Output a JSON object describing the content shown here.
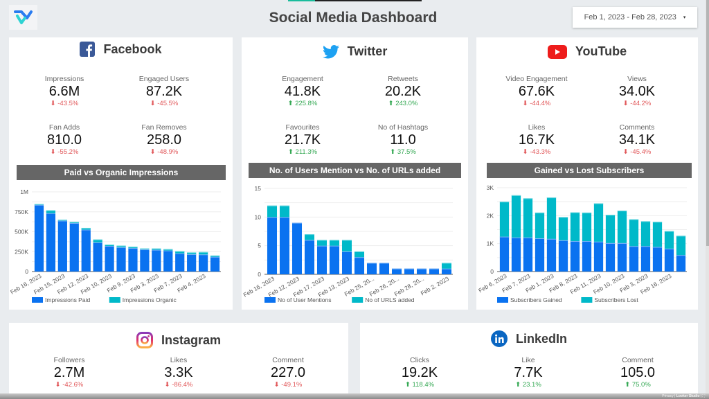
{
  "header": {
    "title": "Social Media Dashboard",
    "date_range": "Feb 1, 2023 - Feb 28, 2023",
    "date_caret": "▾",
    "logo_icon": "v-logo-icon"
  },
  "colors": {
    "primary_bar": "#0a72f0",
    "secondary_bar": "#00b9c9",
    "negative": "#e15759",
    "positive": "#34a853",
    "chart_title_bg": "#666666"
  },
  "facebook": {
    "name": "Facebook",
    "icon": "facebook-icon",
    "kpis": [
      {
        "label": "Impressions",
        "value": "6.6M",
        "change": "-43.5%",
        "dir": "down"
      },
      {
        "label": "Engaged Users",
        "value": "87.2K",
        "change": "-45.5%",
        "dir": "down"
      },
      {
        "label": "Fan Adds",
        "value": "810.0",
        "change": "-55.2%",
        "dir": "down"
      },
      {
        "label": "Fan Removes",
        "value": "258.0",
        "change": "-48.9%",
        "dir": "down"
      }
    ]
  },
  "twitter": {
    "name": "Twitter",
    "icon": "twitter-icon",
    "kpis": [
      {
        "label": "Engagement",
        "value": "41.8K",
        "change": "225.8%",
        "dir": "up"
      },
      {
        "label": "Retweets",
        "value": "20.2K",
        "change": "243.0%",
        "dir": "up"
      },
      {
        "label": "Favourites",
        "value": "21.7K",
        "change": "211.3%",
        "dir": "up"
      },
      {
        "label": "No of Hashtags",
        "value": "11.0",
        "change": "37.5%",
        "dir": "up"
      }
    ]
  },
  "youtube": {
    "name": "YouTube",
    "icon": "youtube-icon",
    "kpis": [
      {
        "label": "Video Engagement",
        "value": "67.6K",
        "change": "-44.4%",
        "dir": "down"
      },
      {
        "label": "Views",
        "value": "34.0K",
        "change": "-44.2%",
        "dir": "down"
      },
      {
        "label": "Likes",
        "value": "16.7K",
        "change": "-43.3%",
        "dir": "down"
      },
      {
        "label": "Comments",
        "value": "34.1K",
        "change": "-45.4%",
        "dir": "down"
      }
    ]
  },
  "instagram": {
    "name": "Instagram",
    "icon": "instagram-icon",
    "kpis": [
      {
        "label": "Followers",
        "value": "2.7M",
        "change": "-42.6%",
        "dir": "down"
      },
      {
        "label": "Likes",
        "value": "3.3K",
        "change": "-86.4%",
        "dir": "down"
      },
      {
        "label": "Comment",
        "value": "227.0",
        "change": "-49.1%",
        "dir": "down"
      }
    ]
  },
  "linkedin": {
    "name": "LinkedIn",
    "icon": "linkedin-icon",
    "kpis": [
      {
        "label": "Clicks",
        "value": "19.2K",
        "change": "118.4%",
        "dir": "up"
      },
      {
        "label": "Like",
        "value": "7.7K",
        "change": "23.1%",
        "dir": "up"
      },
      {
        "label": "Comment",
        "value": "105.0",
        "change": "75.0%",
        "dir": "up"
      }
    ]
  },
  "footer": {
    "privacy": "Privacy",
    "brand": "Looker Studio",
    "fullscreen_icon": "⛶"
  },
  "chart_data": [
    {
      "id": "fb",
      "type": "bar",
      "stacked": true,
      "title": "Paid vs Organic Impressions",
      "ylim": [
        0,
        1000000
      ],
      "yticks": [
        0,
        250000,
        500000,
        750000,
        1000000
      ],
      "ytick_labels": [
        "0",
        "250K",
        "500K",
        "750K",
        "1M"
      ],
      "grid": true,
      "legend": "bottom",
      "tick_labels": [
        "Feb 16, 2023",
        "Feb 15, 2023",
        "Feb 12, 2023",
        "Feb 10, 2023",
        "Feb 9, 2023",
        "Feb 3, 2023",
        "Feb 7, 2023",
        "Feb 4, 2023"
      ],
      "series": [
        {
          "name": "Impressions Paid",
          "values": [
            837000,
            733000,
            639000,
            609000,
            526000,
            366000,
            322000,
            306000,
            295000,
            278000,
            273000,
            264000,
            229000,
            218000,
            215000,
            185000
          ]
        },
        {
          "name": "Impressions Organic",
          "values": [
            11000,
            36000,
            11000,
            14000,
            22000,
            36000,
            17000,
            19000,
            16000,
            11000,
            16000,
            17000,
            27000,
            22000,
            30000,
            16000
          ]
        }
      ]
    },
    {
      "id": "tw",
      "type": "bar",
      "stacked": true,
      "title": "No. of Users Mention vs No. of URLs added",
      "ylim": [
        0,
        15
      ],
      "yticks": [
        0,
        5,
        10,
        15
      ],
      "ytick_labels": [
        "0",
        "5",
        "10",
        "15"
      ],
      "grid": true,
      "legend": "bottom",
      "tick_labels": [
        "Feb 16, 2023",
        "Feb 12, 2023",
        "Feb 17, 2023",
        "Feb 13, 2023",
        "Feb 25, 20...",
        "Feb 26, 20...",
        "Feb 28, 20...",
        "Feb 2, 2023"
      ],
      "series": [
        {
          "name": "No of User Mentions",
          "values": [
            10,
            10,
            9,
            6,
            5,
            5,
            4,
            3,
            2,
            2,
            1,
            1,
            1,
            1,
            1
          ]
        },
        {
          "name": "No of URLS added",
          "values": [
            2,
            2,
            0,
            1,
            1,
            1,
            2,
            1,
            0,
            0,
            0,
            0,
            0,
            0,
            1
          ]
        }
      ]
    },
    {
      "id": "yt",
      "type": "bar",
      "stacked": true,
      "title": "Gained vs Lost Subscribers",
      "ylim": [
        0,
        3000
      ],
      "yticks": [
        0,
        1000,
        2000,
        3000
      ],
      "ytick_labels": [
        "0",
        "1K",
        "2K",
        "3K"
      ],
      "grid": true,
      "legend": "bottom",
      "tick_labels": [
        "Feb 6, 2023",
        "Feb 7, 2023",
        "Feb 1, 2023",
        "Feb 8, 2023",
        "Feb 11, 2023",
        "Feb 10, 2023",
        "Feb 3, 2023",
        "Feb 16, 2023"
      ],
      "series": [
        {
          "name": "Subscribers Gained",
          "values": [
            1250,
            1220,
            1220,
            1190,
            1170,
            1120,
            1090,
            1090,
            1070,
            1020,
            1020,
            910,
            910,
            880,
            820,
            590
          ]
        },
        {
          "name": "Subscribers Lost",
          "values": [
            1250,
            1510,
            1400,
            920,
            1480,
            830,
            1030,
            1020,
            1370,
            1010,
            1160,
            960,
            890,
            900,
            630,
            690
          ]
        }
      ]
    }
  ]
}
